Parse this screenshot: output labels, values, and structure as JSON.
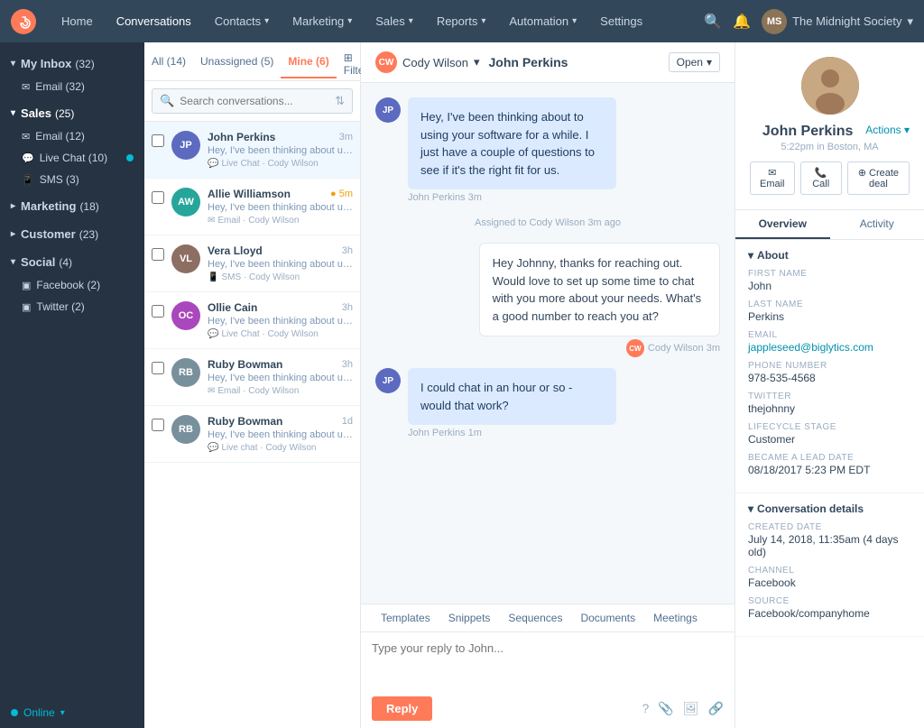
{
  "nav": {
    "items": [
      {
        "label": "Home",
        "active": false
      },
      {
        "label": "Conversations",
        "active": true,
        "has_caret": false
      },
      {
        "label": "Contacts",
        "active": false,
        "has_caret": true
      },
      {
        "label": "Marketing",
        "active": false,
        "has_caret": true
      },
      {
        "label": "Sales",
        "active": false,
        "has_caret": true
      },
      {
        "label": "Reports",
        "active": false,
        "has_caret": true
      },
      {
        "label": "Automation",
        "active": false,
        "has_caret": true
      },
      {
        "label": "Settings",
        "active": false,
        "has_caret": false
      }
    ],
    "user_name": "The Midnight Society"
  },
  "sidebar": {
    "sections": [
      {
        "label": "My Inbox",
        "count": "32",
        "items": [
          {
            "label": "Email",
            "count": "(32)",
            "icon": "✉"
          }
        ]
      },
      {
        "label": "Sales",
        "count": "25",
        "items": [
          {
            "label": "Email",
            "count": "(12)",
            "icon": "✉"
          },
          {
            "label": "Live Chat",
            "count": "(10)",
            "icon": "💬",
            "dot": true
          },
          {
            "label": "SMS",
            "count": "(3)",
            "icon": "📱"
          }
        ]
      },
      {
        "label": "Marketing",
        "count": "18",
        "items": []
      },
      {
        "label": "Customer",
        "count": "23",
        "items": []
      },
      {
        "label": "Social",
        "count": "4",
        "items": [
          {
            "label": "Facebook",
            "count": "(2)",
            "icon": "▣"
          },
          {
            "label": "Twitter",
            "count": "(2)",
            "icon": "▣"
          }
        ]
      }
    ],
    "online_label": "Online"
  },
  "conv_list": {
    "tabs": [
      {
        "label": "All",
        "count": "14"
      },
      {
        "label": "Unassigned",
        "count": "5"
      },
      {
        "label": "Mine",
        "count": "6",
        "active": true
      }
    ],
    "filter_label": "Filter",
    "search_placeholder": "Search conversations...",
    "items": [
      {
        "name": "John Perkins",
        "time": "3m",
        "time_class": "",
        "preview": "Hey, I've been thinking about using your software for a while. I just ha...",
        "channel": "Live Chat · Cody Wilson",
        "avatar_class": "av1",
        "initials": "JP",
        "selected": true
      },
      {
        "name": "Allie Williamson",
        "time": "5m",
        "time_class": "recent",
        "preview": "Hey, I've been thinking about using your software for a while. I just ha...",
        "channel": "Email · Cody Wilson",
        "avatar_class": "av2",
        "initials": "AW",
        "selected": false
      },
      {
        "name": "Vera Lloyd",
        "time": "3h",
        "time_class": "",
        "preview": "Hey, I've been thinking about using your software for a while. I just ha...",
        "channel": "SMS · Cody Wilson",
        "avatar_class": "av3",
        "initials": "VL",
        "selected": false
      },
      {
        "name": "Ollie Cain",
        "time": "3h",
        "time_class": "",
        "preview": "Hey, I've been thinking about using your software for a while. I just ha...",
        "channel": "Live Chat · Cody Wilson",
        "avatar_class": "av4",
        "initials": "OC",
        "selected": false
      },
      {
        "name": "Ruby Bowman",
        "time": "3h",
        "time_class": "",
        "preview": "Hey, I've been thinking about using your software for a while. I just ha...",
        "channel": "Email · Cody Wilson",
        "avatar_class": "av5",
        "initials": "RB",
        "selected": false
      },
      {
        "name": "Ruby Bowman",
        "time": "1d",
        "time_class": "",
        "preview": "Hey, I've been thinking about using your software for a while. I just ha...",
        "channel": "Live chat · Cody Wilson",
        "avatar_class": "av5",
        "initials": "RB",
        "selected": false
      }
    ]
  },
  "chat": {
    "assignee": "Cody Wilson",
    "customer_name": "John Perkins",
    "status": "Open",
    "messages": [
      {
        "type": "customer",
        "text": "Hey, I've been thinking about to using your software for a while. I just have a couple of questions to see if it's the right fit for us.",
        "sender": "John Perkins",
        "time": "3m"
      },
      {
        "type": "system",
        "text": "Assigned to Cody Wilson 3m ago"
      },
      {
        "type": "agent",
        "text": "Hey Johnny, thanks for reaching out. Would love to set up some time to chat with you more about your needs. What's a good number to reach you at?",
        "sender": "Cody Wilson",
        "time": "3m"
      },
      {
        "type": "customer",
        "text": "I could chat in an hour or so - would that work?",
        "sender": "John Perkins",
        "time": "1m"
      }
    ],
    "reply": {
      "tabs": [
        "Templates",
        "Snippets",
        "Sequences",
        "Documents",
        "Meetings"
      ],
      "placeholder": "Type your reply to John...",
      "button_label": "Reply"
    }
  },
  "contact": {
    "name": "John Perkins",
    "location": "5:22pm in Boston, MA",
    "actions": [
      "Email",
      "Call",
      "Create deal"
    ],
    "tabs": [
      "Overview",
      "Activity"
    ],
    "about": {
      "first_name_label": "First name",
      "first_name": "John",
      "last_name_label": "Last Name",
      "last_name": "Perkins",
      "email_label": "Email",
      "email": "jappleseed@biglytics.com",
      "phone_label": "Phone Number",
      "phone": "978-535-4568",
      "twitter_label": "Twitter",
      "twitter": "thejohnny",
      "lifecycle_label": "Lifecycle Stage",
      "lifecycle": "Customer",
      "lead_date_label": "Became a Lead Date",
      "lead_date": "08/18/2017 5:23 PM EDT"
    },
    "conversation": {
      "section_label": "Conversation details",
      "created_label": "Created date",
      "created": "July 14, 2018, 11:35am (4 days old)",
      "channel_label": "Channel",
      "channel": "Facebook",
      "source_label": "Source",
      "source": "Facebook/companyhome"
    },
    "actions_label": "Actions"
  }
}
